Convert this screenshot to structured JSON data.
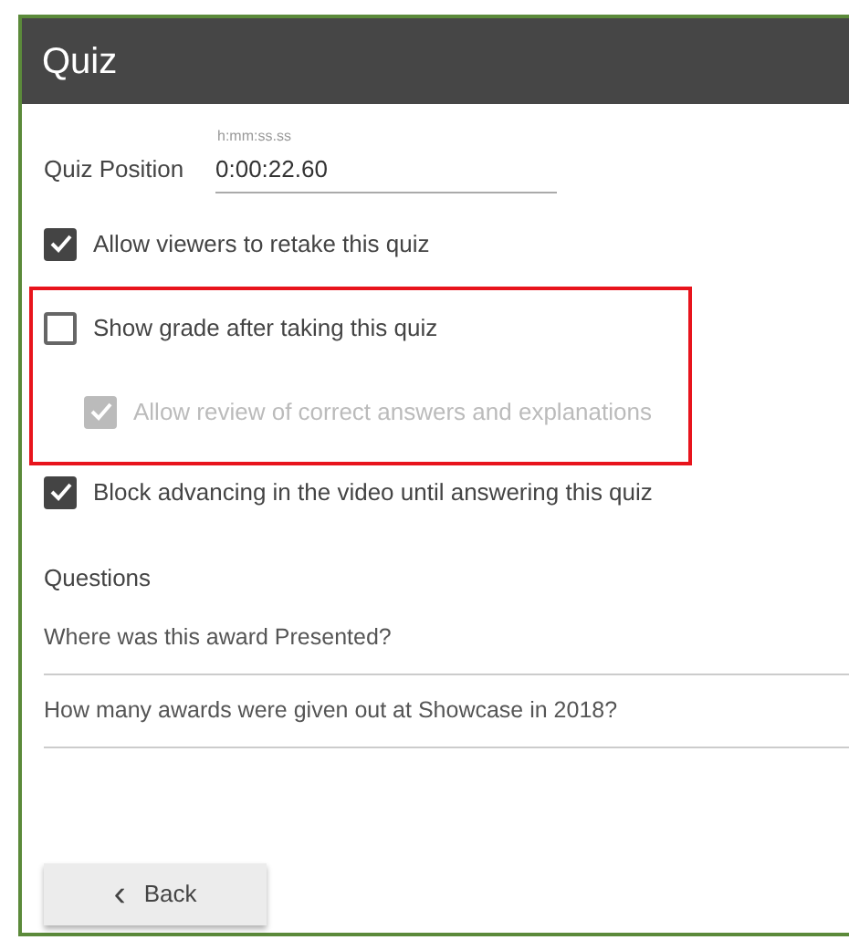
{
  "header": {
    "title": "Quiz"
  },
  "position": {
    "label": "Quiz Position",
    "placeholder": "h:mm:ss.ss",
    "value": "0:00:22.60"
  },
  "options": [
    {
      "label": "Allow viewers to retake this quiz",
      "checked": true,
      "disabled": false,
      "highlighted": false
    },
    {
      "label": "Show grade after taking this quiz",
      "checked": false,
      "disabled": false,
      "highlighted": true,
      "children": [
        {
          "label": "Allow review of correct answers and explanations",
          "checked": true,
          "disabled": true
        }
      ]
    },
    {
      "label": "Block advancing in the video until answering this quiz",
      "checked": true,
      "disabled": false,
      "highlighted": false
    }
  ],
  "questions": {
    "heading": "Questions",
    "items": [
      "Where was this award Presented?",
      "How many awards were given out at Showcase in 2018?"
    ]
  },
  "back_button": {
    "icon": "‹",
    "label": "Back"
  }
}
